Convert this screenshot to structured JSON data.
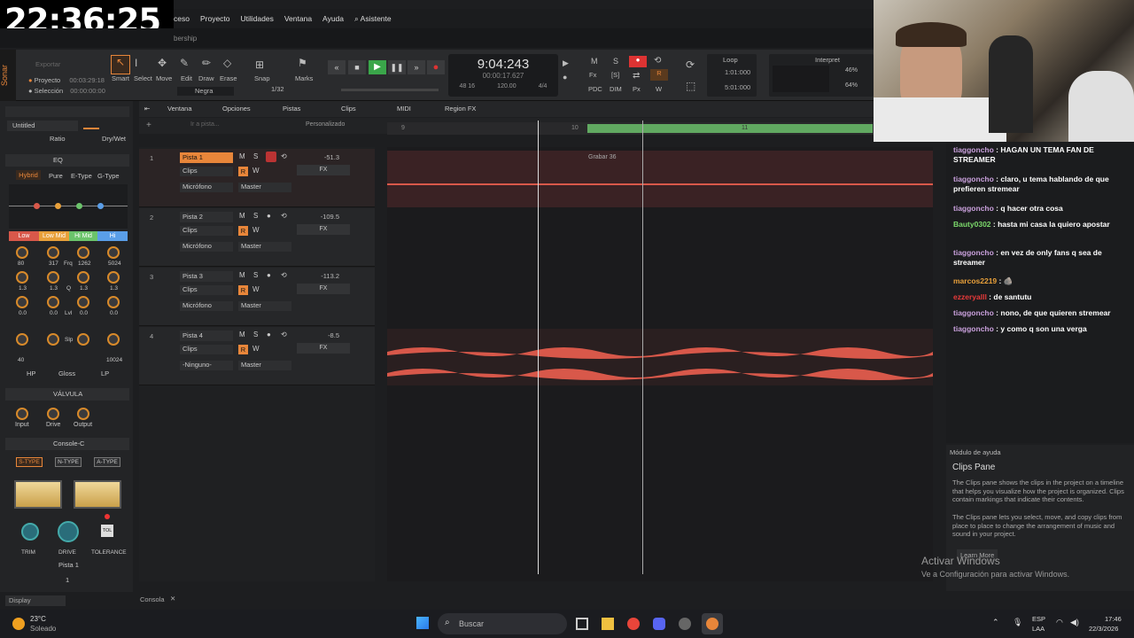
{
  "overlay": {
    "clock": "22:36:25"
  },
  "menu": [
    "ceso",
    "Proyecto",
    "Utilidades",
    "Ventana",
    "Ayuda",
    "Asistente"
  ],
  "subbar": {
    "text": "bership"
  },
  "transport": {
    "export": "Exportar",
    "project_label": "Proyecto",
    "project_time": "00:03:29:18",
    "selection_label": "Selección",
    "selection_time": "00:00:00:00",
    "tools": [
      "Smart",
      "Select",
      "Move",
      "Edit",
      "Draw",
      "Erase"
    ],
    "snap": "Snap",
    "marks": "Marks",
    "snap_value": "1/32",
    "note": "Negra",
    "time_main": "9:04:243",
    "time_sub": "00:00:17.627",
    "tempo": "120.00",
    "meter": "4/4",
    "loop_label": "Loop",
    "loop_start": "1:01:000",
    "loop_end": "5:01:000",
    "interpret_label": "Interpret",
    "pct1": "46%",
    "pct2": "64%",
    "bits": "48 16"
  },
  "inspector": {
    "preset": "Untitled",
    "ratio": "Ratio",
    "drywet": "Dry/Wet",
    "eq_title": "EQ",
    "eq_types": [
      "Hybrid",
      "Pure",
      "E-Type",
      "G-Type"
    ],
    "bands": [
      "Low",
      "Low Mid",
      "Hi Mid",
      "Hi"
    ],
    "freqs": [
      "80",
      "317",
      "1262",
      "5024"
    ],
    "frq": "Frq",
    "qs": [
      "1.3",
      "1.3",
      "1.3",
      "1.3"
    ],
    "q": "Q",
    "lvls": [
      "0.0",
      "0.0",
      "0.0",
      "0.0"
    ],
    "lvl": "Lvl",
    "slp": "Slp",
    "hpv": "40",
    "lpv": "10024",
    "filters": [
      "HP",
      "Gloss",
      "LP"
    ],
    "valve_title": "VÁLVULA",
    "valve_knobs": [
      "Input",
      "Drive",
      "Output"
    ],
    "console_title": "Console-C",
    "console_types": [
      "S-TYPE",
      "N-TYPE",
      "A-TYPE"
    ],
    "console_knobs": [
      "TRIM",
      "DRIVE",
      "TOLERANCE"
    ],
    "track_name": "Pista 1",
    "track_num": "1",
    "display": "Display"
  },
  "trackview": {
    "menus": [
      "Ventana",
      "Opciones",
      "Pistas",
      "Clips",
      "MIDI",
      "Region FX"
    ],
    "goto": "Ir a pista...",
    "custom": "Personalizado",
    "ruler": [
      "9",
      "10",
      "11"
    ],
    "clip_label": "Grabar 36"
  },
  "tracks": [
    {
      "num": "1",
      "name": "Pista 1",
      "vol": "-51.3",
      "clips": "Clips",
      "input": "Micrófono",
      "output": "Master",
      "fx": "FX"
    },
    {
      "num": "2",
      "name": "Pista 2",
      "vol": "-109.5",
      "clips": "Clips",
      "input": "Micrófono",
      "output": "Master",
      "fx": "FX"
    },
    {
      "num": "3",
      "name": "Pista 3",
      "vol": "-113.2",
      "clips": "Clips",
      "input": "Micrófono",
      "output": "Master",
      "fx": "FX"
    },
    {
      "num": "4",
      "name": "Pista 4",
      "vol": "-8.5",
      "clips": "Clips",
      "input": "-Ninguno-",
      "output": "Master",
      "fx": "FX"
    }
  ],
  "chat": [
    {
      "user": "tiaggoncho",
      "text": "HAGAN UN TEMA FAN DE STREAMER"
    },
    {
      "user": "tiaggoncho",
      "text": "claro, u tema hablando de que prefieren stremear"
    },
    {
      "user": "tiaggoncho",
      "text": "q hacer otra cosa"
    },
    {
      "user": "Bauty0302",
      "text": "hasta mi casa la quiero apostar"
    },
    {
      "user": "tiaggoncho",
      "text": "en vez de only fans q sea de streamer"
    },
    {
      "user": "marcos2219",
      "text": ""
    },
    {
      "user": "ezzeryalll",
      "text": "de santutu"
    },
    {
      "user": "tiaggoncho",
      "text": "nono, de que quieren stremear"
    },
    {
      "user": "tiaggoncho",
      "text": "y como q son una verga"
    }
  ],
  "help": {
    "title": "Módulo de ayuda",
    "heading": "Clips Pane",
    "p1": "The Clips pane shows the clips in the project on a timeline that helps you visualize how the project is organized. Clips contain markings that indicate their contents.",
    "p2": "The Clips pane lets you select, move, and copy clips from place to place to change the arrangement of music and sound in your project.",
    "learn": "Learn More",
    "activate1": "Activar Windows",
    "activate2": "Ve a Configuración para activar Windows."
  },
  "bottom": {
    "console": "Consola"
  },
  "taskbar": {
    "temp": "23°C",
    "weather": "Soleado",
    "search": "Buscar",
    "lang1": "ESP",
    "lang2": "LAA",
    "time": "17:46",
    "date": "22/3/2026"
  }
}
